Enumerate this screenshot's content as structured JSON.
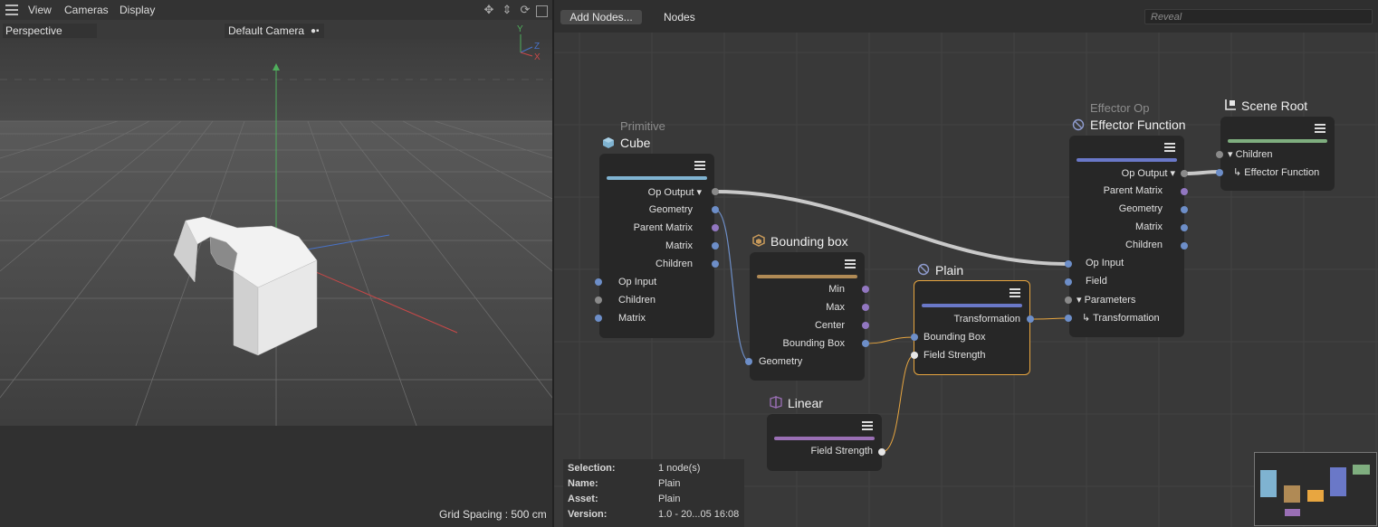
{
  "viewport": {
    "menu": [
      "View",
      "Cameras",
      "Display"
    ],
    "view_mode": "Perspective",
    "camera": "Default Camera",
    "axis_labels": {
      "y": "Y",
      "z": "Z",
      "x": "X"
    },
    "grid_spacing": "Grid Spacing : 500 cm"
  },
  "editor": {
    "add_nodes_label": "Add Nodes...",
    "nodes_menu": "Nodes",
    "reveal_placeholder": "Reveal"
  },
  "nodes": {
    "cube": {
      "category": "Primitive",
      "title": "Cube",
      "color": "#7fb3d1",
      "outputs": [
        "Op Output",
        "Geometry",
        "Parent Matrix",
        "Matrix",
        "Children"
      ],
      "inputs": [
        "Op Input",
        "Children",
        "Matrix"
      ]
    },
    "bbox": {
      "title": "Bounding box",
      "color": "#b08a55",
      "outputs": [
        "Min",
        "Max",
        "Center",
        "Bounding Box"
      ],
      "inputs": [
        "Geometry"
      ]
    },
    "plain": {
      "title": "Plain",
      "color": "#6a78c8",
      "outputs": [
        "Transformation"
      ],
      "inputs": [
        "Bounding Box",
        "Field Strength"
      ]
    },
    "linear": {
      "title": "Linear",
      "color": "#9a6fb5",
      "outputs": [
        "Field Strength"
      ]
    },
    "effector": {
      "category": "Effector Op",
      "title": "Effector Function",
      "color": "#6a78c8",
      "outputs": [
        "Op Output",
        "Parent Matrix",
        "Geometry",
        "Matrix",
        "Children"
      ],
      "inputs": [
        "Op Input",
        "Field",
        "Parameters",
        "Transformation"
      ]
    },
    "scene_root": {
      "title": "Scene Root",
      "color": "#7fae7f",
      "inputs": [
        "Children",
        "Effector Function"
      ]
    }
  },
  "info": {
    "labels": [
      "Selection:",
      "Name:",
      "Asset:",
      "Version:"
    ],
    "values": [
      "1 node(s)",
      "Plain",
      "Plain",
      "1.0 - 20...05 16:08"
    ]
  }
}
